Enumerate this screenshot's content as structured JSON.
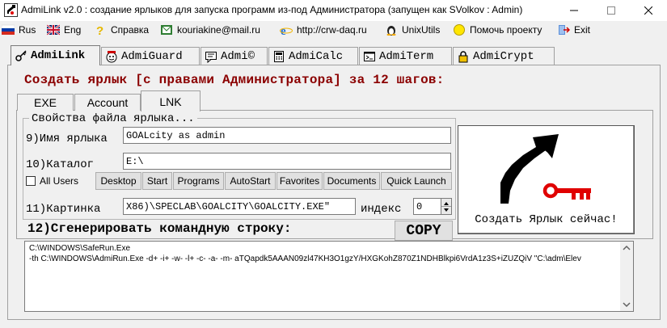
{
  "window": {
    "title": "AdmiLink v2.0 : создание ярлыков для запуска программ из-под Администратора (запущен как SVolkov : Admin)",
    "minimize_icon": "minimize-icon",
    "maximize_icon": "maximize-icon",
    "close_icon": "close-icon"
  },
  "menu": {
    "items": [
      {
        "label": "Rus",
        "icon": "russia-flag-icon"
      },
      {
        "label": "Eng",
        "icon": "uk-flag-icon"
      },
      {
        "label": "Справка",
        "icon": "help-icon"
      },
      {
        "label": "kouriakine@mail.ru",
        "icon": "mail-icon"
      },
      {
        "label": "http://crw-daq.ru",
        "icon": "ie-icon"
      },
      {
        "label": "UnixUtils",
        "icon": "tux-icon"
      },
      {
        "label": "Помочь проекту",
        "icon": "coin-icon"
      },
      {
        "label": "Exit",
        "icon": "exit-icon"
      }
    ]
  },
  "tabs": [
    {
      "label": "AdmiLink",
      "icon": "key-icon"
    },
    {
      "label": "AdmiGuard",
      "icon": "guard-icon"
    },
    {
      "label": "Admi©",
      "icon": "chat-icon"
    },
    {
      "label": "AdmiCalc",
      "icon": "calculator-icon"
    },
    {
      "label": "AdmiTerm",
      "icon": "terminal-icon"
    },
    {
      "label": "AdmiCrypt",
      "icon": "lock-icon"
    }
  ],
  "heading": "Создать ярлык [с правами Администратора] за 12 шагов:",
  "subtabs": [
    "EXE",
    "Account",
    "LNK"
  ],
  "group_title": "Свойства файла ярлыка...",
  "form": {
    "name_label": "9)Имя ярлыка",
    "name_value": "GOALcity as admin",
    "dir_label": "10)Каталог",
    "dir_value": "E:\\",
    "all_users_label": "All Users",
    "buttons": [
      "Desktop",
      "Start",
      "Programs",
      "AutoStart",
      "Favorites",
      "Documents",
      "Quick Launch"
    ],
    "icon_label": "11)Картинка",
    "icon_value": "X86)\\SPECLAB\\GOALCITY\\GOALCITY.EXE\"",
    "index_label": "индекс",
    "index_value": "0"
  },
  "big_button_label": "Создать Ярлык сейчас!",
  "generate_label": "12)Сгенерировать командную строку:",
  "copy_label": "COPY",
  "command": {
    "line1": "C:\\WINDOWS\\SafeRun.Exe",
    "line2": " -th C:\\WINDOWS\\AdmiRun.Exe -d+ -i+ -w- -l+ -c- -a- -m- aTQapdk5AAAN09zl47KH3O1gzY/HXGKohZ870Z1NDHBlkpi6VrdA1z3S+iZUZQiV \"C:\\adm\\Elev"
  },
  "colors": {
    "heading": "#8b0000",
    "accent_red": "#e00000"
  }
}
